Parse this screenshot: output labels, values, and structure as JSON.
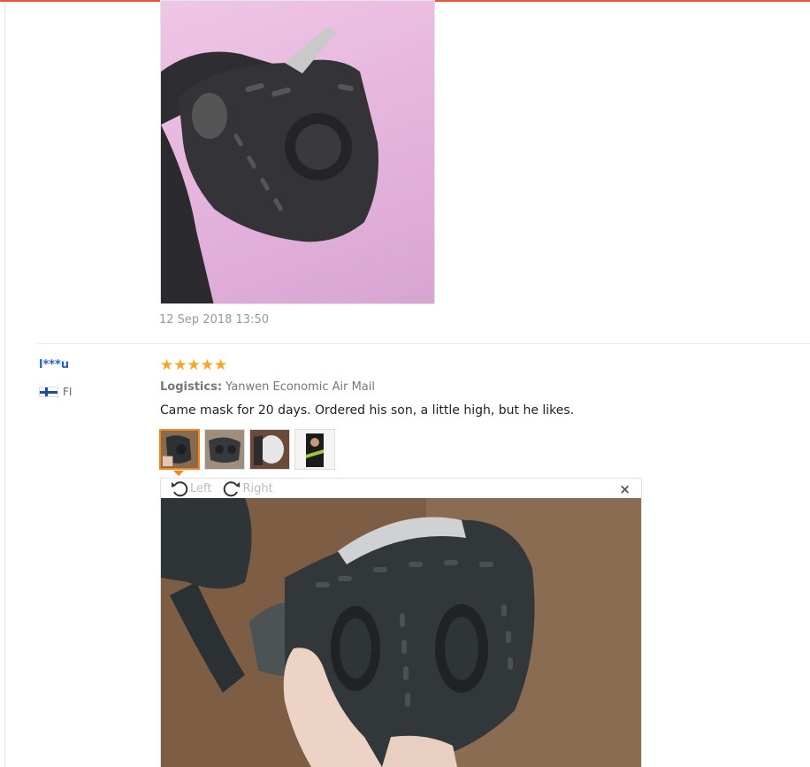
{
  "previous_review": {
    "date": "12 Sep 2018 13:50"
  },
  "review": {
    "user": "l***u",
    "country_code": "FI",
    "stars": "★★★★★",
    "rating": 5,
    "logistics_label": "Logistics:",
    "logistics_value": "Yanwen Economic Air Mail",
    "text": "Came mask for 20 days. Ordered his son, a little high, but he likes.",
    "photo_count": 4,
    "selected_photo": 1
  },
  "viewer": {
    "rotate_left_label": "Left",
    "rotate_right_label": "Right",
    "close_symbol": "×"
  },
  "icons": {
    "rotate_left": "rotate-left-icon",
    "rotate_right": "rotate-right-icon",
    "close": "close-icon",
    "flag": "finland-flag-icon"
  },
  "colors": {
    "accent": "#e8533a",
    "star": "#f5a623",
    "username": "#2a62b8",
    "thumb_active": "#f0841f"
  }
}
